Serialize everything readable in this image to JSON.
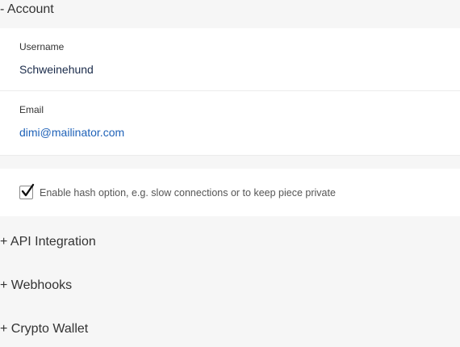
{
  "sections": {
    "account": "- Account",
    "api": "+ API Integration",
    "webhooks": "+ Webhooks",
    "crypto": "+ Crypto Wallet"
  },
  "account": {
    "username_label": "Username",
    "username_value": "Schweinehund",
    "email_label": "Email",
    "email_value": "dimi@mailinator.com"
  },
  "options": {
    "hash_checked": true,
    "hash_label": "Enable hash option, e.g. slow connections or to keep piece private"
  },
  "colors": {
    "page_bg": "#f6f6f6",
    "card_bg": "#ffffff",
    "link": "#1f62b8"
  }
}
